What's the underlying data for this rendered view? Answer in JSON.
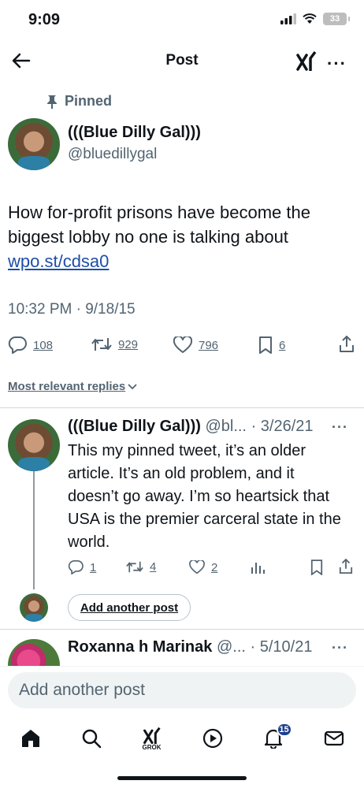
{
  "status_bar": {
    "time": "9:09",
    "battery": "33"
  },
  "header": {
    "title": "Post",
    "more": "···"
  },
  "pinned_label": "Pinned",
  "main_post": {
    "name": "(((Blue Dilly Gal)))",
    "handle": "@bluedillygal",
    "text": "How for-profit prisons have become the biggest lobby no one is talking about",
    "link": "wpo.st/cdsa0",
    "timestamp": "10:32 PM · 9/18/15",
    "replies": "108",
    "reposts": "929",
    "likes": "796",
    "bookmarks": "6"
  },
  "replies_sort": "Most relevant replies",
  "reply": {
    "name": "(((Blue Dilly Gal)))",
    "handle": "@bl...",
    "date": "· 3/26/21",
    "more": "···",
    "text": "This my pinned tweet, it’s an older article. It’s an old problem, and it doesn’t go away. I’m so heartsick that USA is the premier carceral state in the world.",
    "replies": "1",
    "reposts": "4",
    "likes": "2"
  },
  "add_another_post_button": "Add another post",
  "reply2": {
    "name": "Roxanna h Marinak",
    "handle": "@...",
    "date": "· 5/10/21",
    "more": "···"
  },
  "compose_placeholder": "Add another post",
  "tabbar": {
    "grok_label": "GROK",
    "notifications_badge": "15"
  },
  "colors": {
    "link": "#1d4ea8",
    "muted": "#536471",
    "badge": "#1d3f8f"
  }
}
